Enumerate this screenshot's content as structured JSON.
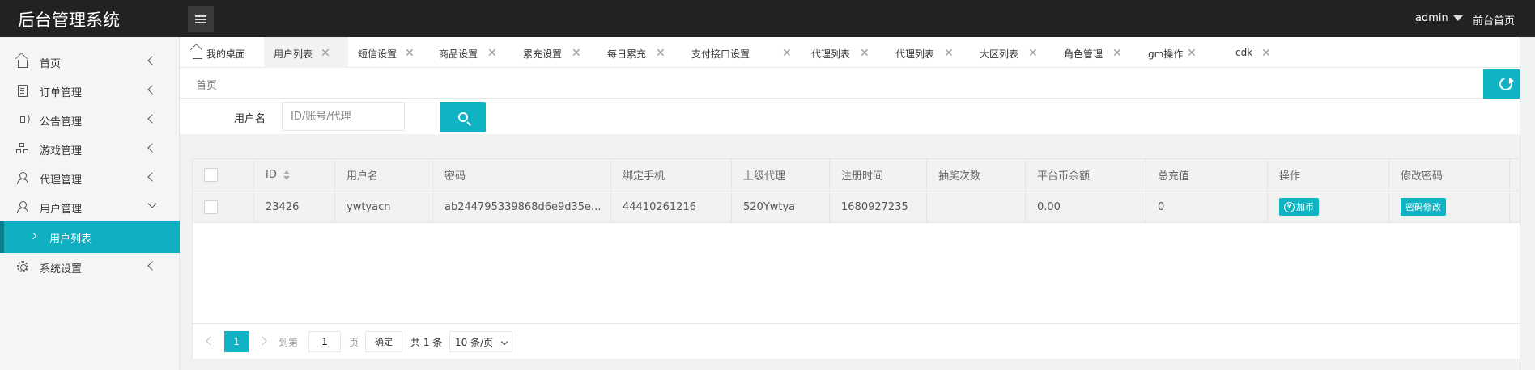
{
  "app": {
    "title": "后台管理系统"
  },
  "topbar": {
    "user": "admin",
    "home_link": "前台首页"
  },
  "sidebar": {
    "items": [
      {
        "label": "首页",
        "icon": "home-icon"
      },
      {
        "label": "订单管理",
        "icon": "document-icon"
      },
      {
        "label": "公告管理",
        "icon": "speaker-icon"
      },
      {
        "label": "游戏管理",
        "icon": "hierarchy-icon"
      },
      {
        "label": "代理管理",
        "icon": "agent-icon"
      },
      {
        "label": "用户管理",
        "icon": "user-icon"
      },
      {
        "label": "系统设置",
        "icon": "gear-icon"
      }
    ],
    "sub_active": "用户列表"
  },
  "tabs": [
    {
      "label": "我的桌面",
      "closable": false
    },
    {
      "label": "用户列表",
      "closable": true,
      "active": true
    },
    {
      "label": "短信设置",
      "closable": true
    },
    {
      "label": "商品设置",
      "closable": true
    },
    {
      "label": "累充设置",
      "closable": true
    },
    {
      "label": "每日累充",
      "closable": true
    },
    {
      "label": "支付接口设置",
      "closable": true
    },
    {
      "label": "代理列表",
      "closable": true
    },
    {
      "label": "代理列表",
      "closable": true
    },
    {
      "label": "大区列表",
      "closable": true
    },
    {
      "label": "角色管理",
      "closable": true
    },
    {
      "label": "gm操作",
      "closable": true
    },
    {
      "label": "cdk",
      "closable": true
    }
  ],
  "breadcrumb": "首页",
  "search": {
    "label": "用户名",
    "placeholder": "ID/账号/代理"
  },
  "table": {
    "headers": [
      "ID",
      "用户名",
      "密码",
      "绑定手机",
      "上级代理",
      "注册时间",
      "抽奖次数",
      "平台币余额",
      "总充值",
      "操作",
      "修改密码"
    ],
    "rows": [
      {
        "id": "23426",
        "username": "ywtyacn",
        "password": "ab244795339868d6e9d35e...",
        "phone": "44410261216",
        "agent": "520Ywtya",
        "reg_time": "1680927235",
        "lottery": "",
        "balance": "0.00",
        "total_recharge": "0",
        "action": "加币",
        "change_pwd": "密码修改"
      }
    ]
  },
  "pagination": {
    "current": "1",
    "goto_label": "到第",
    "page_input": "1",
    "page_unit": "页",
    "confirm": "确定",
    "total": "共 1 条",
    "page_size": "10 条/页"
  },
  "colors": {
    "accent": "#10b3c4",
    "topbar": "#222222"
  }
}
